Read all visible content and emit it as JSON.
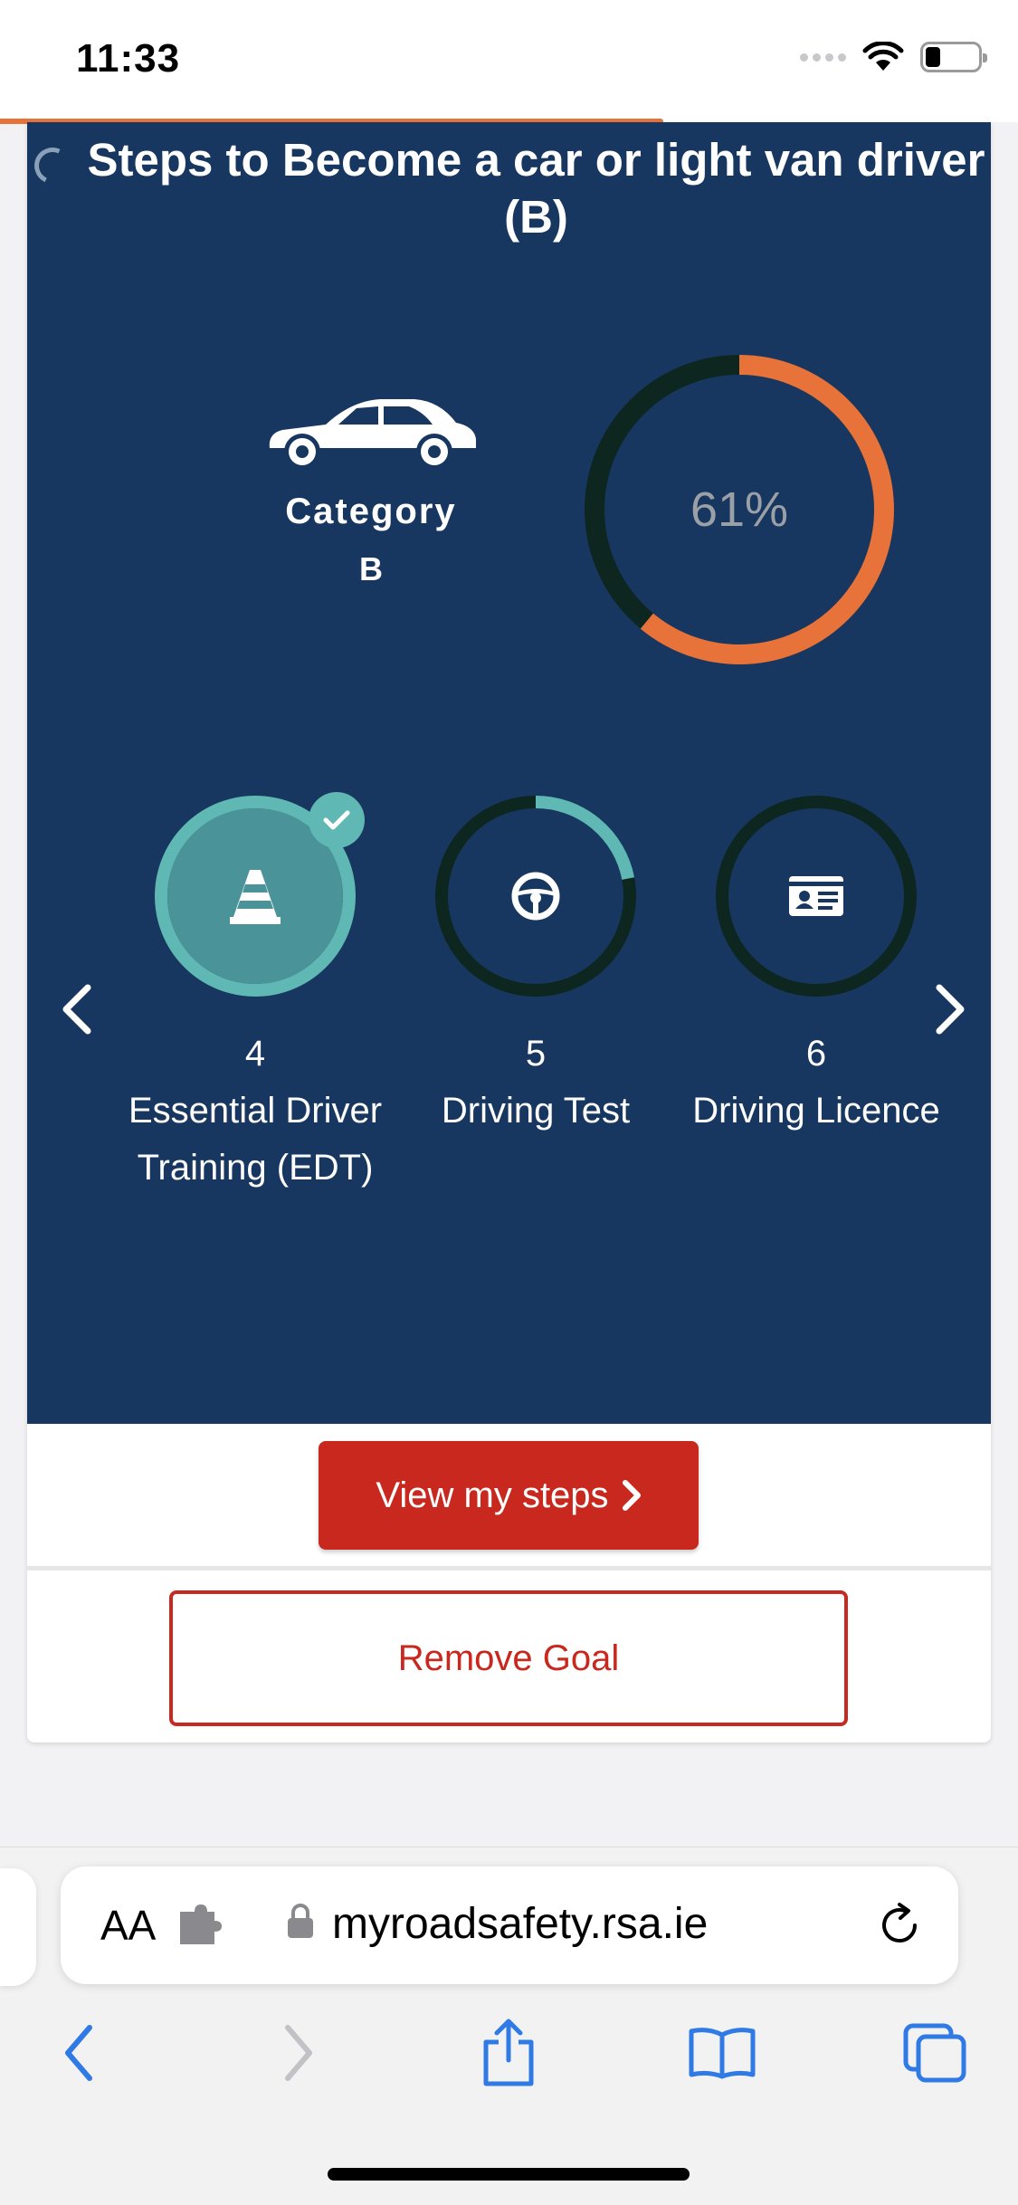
{
  "status_bar": {
    "time": "11:33"
  },
  "goal": {
    "title": "Steps to Become a car or light van driver (B)",
    "category_label": "Category",
    "category_code": "B",
    "progress_text": "61%",
    "progress_fraction": 0.61
  },
  "steps": [
    {
      "number": "4",
      "label": "Essential Driver Training (EDT)",
      "completed": true,
      "progress_fraction": 1.0,
      "icon": "traffic-cone-icon"
    },
    {
      "number": "5",
      "label": "Driving Test",
      "completed": false,
      "progress_fraction": 0.22,
      "icon": "steering-wheel-icon"
    },
    {
      "number": "6",
      "label": "Driving Licence",
      "completed": false,
      "progress_fraction": 0.0,
      "icon": "id-card-icon"
    }
  ],
  "actions": {
    "view_steps": "View my steps",
    "remove_goal": "Remove Goal"
  },
  "browser": {
    "text_size_label": "AA",
    "url": "myroadsafety.rsa.ie"
  },
  "colors": {
    "panel_blue": "#173760",
    "accent_orange": "#e8733a",
    "teal": "#5fb8b4",
    "button_red": "#c8281e",
    "ios_blue": "#2f7ae5"
  }
}
